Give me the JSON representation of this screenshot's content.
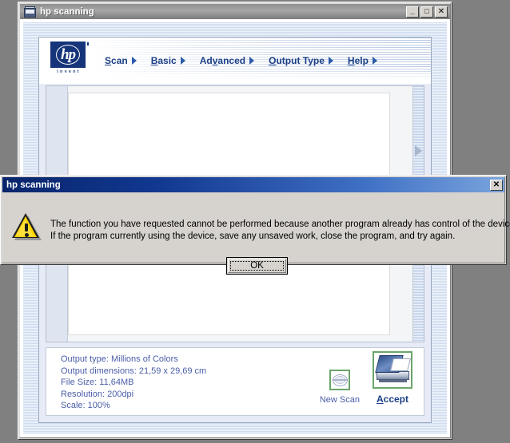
{
  "app": {
    "title": "hp scanning",
    "title_icon": "scanner-icon",
    "window_buttons": {
      "minimize": "_",
      "maximize": "□",
      "close": "✕"
    },
    "logo": {
      "wordmark": "hp",
      "tagline": "invent"
    },
    "menu": [
      {
        "label": "Scan",
        "mnemonic": "S",
        "rest": "can",
        "arrow": "▶"
      },
      {
        "label": "Basic",
        "mnemonic": "B",
        "rest": "asic",
        "arrow": "▶"
      },
      {
        "label": "Advanced",
        "pre": "Ad",
        "mnemonic": "v",
        "rest": "anced",
        "arrow": "▶"
      },
      {
        "label": "Output Type",
        "mnemonic": "O",
        "rest": "utput Type",
        "arrow": "▶"
      },
      {
        "label": "Help",
        "mnemonic": "H",
        "rest": "elp",
        "arrow": "▶"
      }
    ],
    "tools": [
      {
        "name": "select-region-tool"
      },
      {
        "name": "zoom-in-tool"
      },
      {
        "name": "zoom-out-tool"
      }
    ],
    "preview": {
      "scroll_arrow": "▶"
    },
    "info": {
      "output_type": "Output type: Millions of Colors",
      "output_dimensions": "Output dimensions: 21,59 x 29,69 cm",
      "file_size": "File Size: 11,64MB",
      "resolution": "Resolution:  200dpi",
      "scale": "Scale: 100%"
    },
    "actions": {
      "new_scan": {
        "label": "New Scan",
        "icon": "new-scan-icon"
      },
      "accept": {
        "label": "Accept",
        "mnemonic": "A",
        "rest": "ccept",
        "icon": "scanner-accept-icon"
      }
    }
  },
  "dialog": {
    "title": "hp scanning",
    "close_label": "✕",
    "icon": "warning-icon",
    "message_line1": "The function you have requested cannot be performed because another program already has control of the device.",
    "message_line2": "If the program currently using the device, save any unsaved work, close the program, and try again.",
    "ok_label": "OK"
  },
  "colors": {
    "desktop": "#808080",
    "titlebar_active": "#0a2a72",
    "dialog_face": "#d6d3ce",
    "hp_blue": "#15347a",
    "info_text": "#4a5ea8",
    "accent_green": "#6aa56a",
    "warning_yellow": "#ffd400"
  }
}
